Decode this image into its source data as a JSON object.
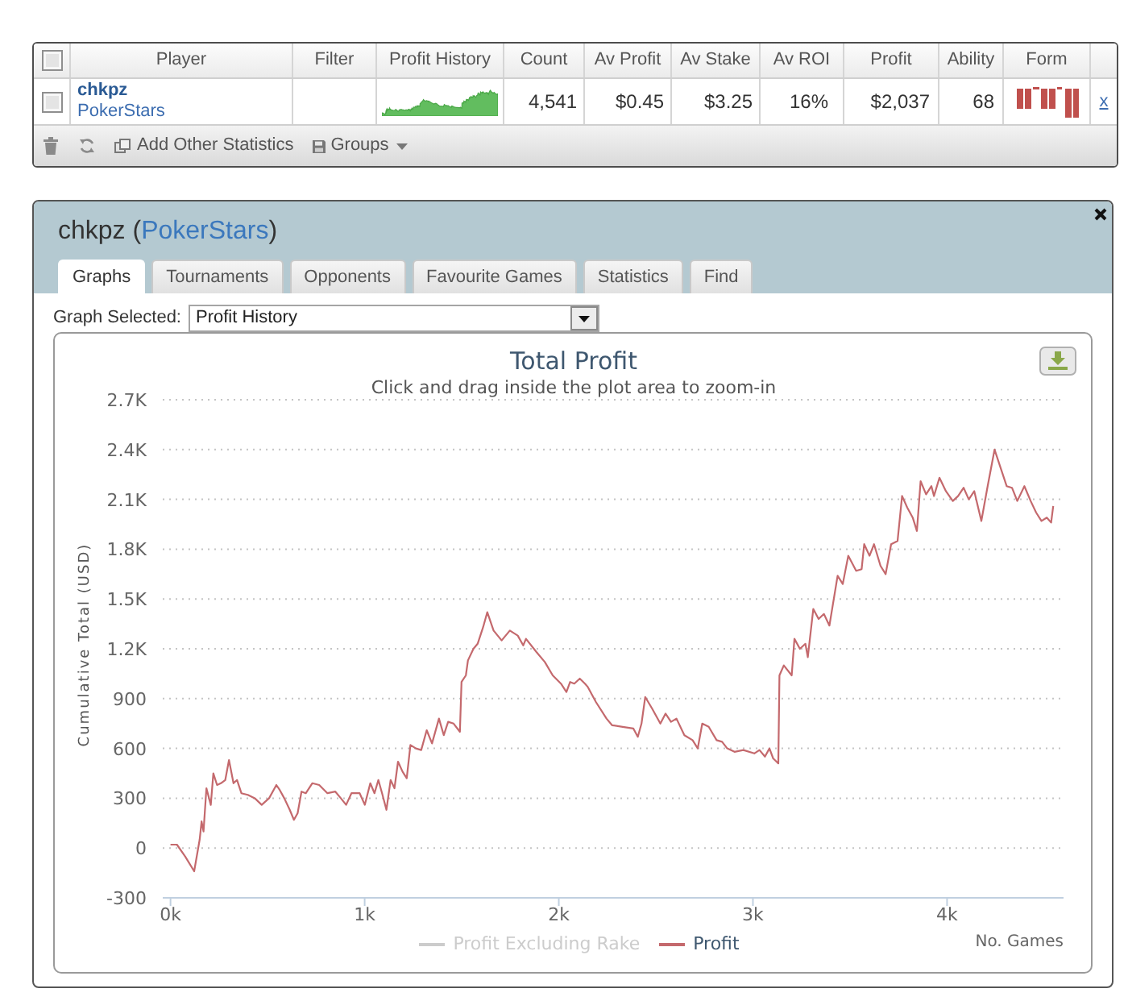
{
  "stats_table": {
    "header_checkbox": {
      "checked": false
    },
    "columns": [
      "Player",
      "Filter",
      "Profit History",
      "Count",
      "Av Profit",
      "Av Stake",
      "Av ROI",
      "Profit",
      "Ability",
      "Form"
    ],
    "rows": [
      {
        "checked": false,
        "player": "chkpz",
        "site": "PokerStars",
        "count": "4,541",
        "av_profit": "$0.45",
        "av_stake": "$3.25",
        "av_roi": "16%",
        "profit": "$2,037",
        "ability": "68",
        "remove": "x"
      }
    ],
    "toolbar": [
      {
        "kind": "delete"
      },
      {
        "kind": "refresh"
      },
      {
        "kind": "add",
        "label": "Add Other Statistics"
      },
      {
        "kind": "groups",
        "label": "Groups"
      }
    ]
  },
  "profile_panel": {
    "title": [
      {
        "kind": "text",
        "text": "chkpz ("
      },
      {
        "kind": "link",
        "text": "PokerStars"
      },
      {
        "kind": "text",
        "text": ")"
      }
    ],
    "tabs": [
      {
        "label": "Graphs",
        "selected": true
      },
      {
        "label": "Tournaments",
        "selected": false
      },
      {
        "label": "Opponents",
        "selected": false
      },
      {
        "label": "Favourite Games",
        "selected": false
      },
      {
        "label": "Statistics",
        "selected": false
      },
      {
        "label": "Find",
        "selected": false
      }
    ],
    "graph_selector": {
      "label": "Graph Selected:",
      "value": "Profit History"
    },
    "chart": {
      "subtitle": "Click and drag inside the plot area to zoom-in",
      "legend": [
        {
          "on": false
        },
        {
          "on": true
        }
      ],
      "chart_data": {
        "type": "line",
        "title": "Total Profit",
        "xlabel": "No. Games",
        "ylabel": "Cumulative Total (USD)",
        "grid": true,
        "x": [
          0,
          33,
          75,
          122,
          150,
          160,
          170,
          185,
          207,
          221,
          240,
          260,
          282,
          301,
          324,
          343,
          365,
          398,
          434,
          470,
          508,
          545,
          563,
          586,
          614,
          636,
          655,
          675,
          697,
          730,
          766,
          808,
          849,
          877,
          905,
          932,
          974,
          1001,
          1029,
          1051,
          1071,
          1090,
          1112,
          1134,
          1154,
          1172,
          1195,
          1217,
          1236,
          1264,
          1291,
          1320,
          1347,
          1383,
          1408,
          1430,
          1458,
          1491,
          1499,
          1521,
          1532,
          1560,
          1582,
          1610,
          1632,
          1664,
          1706,
          1748,
          1789,
          1817,
          1831,
          1886,
          1928,
          1969,
          2011,
          2039,
          2058,
          2080,
          2108,
          2135,
          2150,
          2191,
          2246,
          2274,
          2329,
          2384,
          2407,
          2426,
          2445,
          2481,
          2523,
          2550,
          2578,
          2606,
          2647,
          2689,
          2716,
          2739,
          2772,
          2813,
          2841,
          2868,
          2905,
          2951,
          3007,
          3034,
          3062,
          3085,
          3104,
          3131,
          3137,
          3159,
          3200,
          3214,
          3242,
          3270,
          3283,
          3311,
          3338,
          3366,
          3394,
          3436,
          3463,
          3491,
          3532,
          3560,
          3573,
          3601,
          3624,
          3657,
          3684,
          3712,
          3745,
          3768,
          3795,
          3823,
          3845,
          3864,
          3892,
          3919,
          3933,
          3961,
          3994,
          4030,
          4057,
          4085,
          4112,
          4140,
          4177,
          4209,
          4245,
          4279,
          4307,
          4334,
          4362,
          4398,
          4431,
          4459,
          4486,
          4514,
          4536,
          4547
        ],
        "series": [
          {
            "name": "Profit Excluding Rake",
            "values": [
              null,
              null,
              null,
              null,
              null,
              null,
              null,
              null,
              null,
              null,
              null,
              null,
              null,
              null,
              null,
              null,
              null,
              null,
              null,
              null,
              null,
              null,
              null,
              null,
              null,
              null,
              null,
              null,
              null,
              null,
              null,
              null,
              null,
              null,
              null,
              null,
              null,
              null,
              null,
              null,
              null,
              null,
              null,
              null,
              null,
              null,
              null,
              null,
              null,
              null,
              null,
              null,
              null,
              null,
              null,
              null,
              null,
              null,
              null,
              null,
              null,
              null,
              null,
              null,
              null,
              null,
              null,
              null,
              null,
              null,
              null,
              null,
              null,
              null,
              null,
              null,
              null,
              null,
              null,
              null,
              null,
              null,
              null,
              null,
              null,
              null,
              null,
              null,
              null,
              null,
              null,
              null,
              null,
              null,
              null,
              null,
              null,
              null,
              null,
              null,
              null,
              null,
              null,
              null,
              null,
              null,
              null,
              null,
              null,
              null,
              null,
              null,
              null,
              null,
              null,
              null,
              null,
              null,
              null,
              null,
              null,
              null,
              null,
              null,
              null,
              null,
              null,
              null,
              null,
              null,
              null,
              null,
              null,
              null,
              null,
              null,
              null,
              null,
              null,
              null,
              null,
              null,
              null,
              null,
              null,
              null,
              null,
              null,
              null,
              null,
              null,
              null,
              null,
              null,
              null,
              null,
              null,
              null,
              null,
              null,
              null,
              null
            ]
          },
          {
            "name": "Profit",
            "color": "#c4696d",
            "values": [
              20,
              20,
              -50,
              -140,
              50,
              160,
              100,
              360,
              260,
              450,
              380,
              390,
              410,
              530,
              390,
              410,
              330,
              320,
              300,
              260,
              300,
              380,
              350,
              300,
              230,
              170,
              210,
              340,
              330,
              390,
              380,
              330,
              340,
              300,
              260,
              330,
              330,
              260,
              390,
              330,
              410,
              330,
              230,
              410,
              360,
              520,
              460,
              420,
              620,
              600,
              590,
              710,
              630,
              780,
              680,
              760,
              750,
              700,
              1000,
              1040,
              1130,
              1200,
              1230,
              1330,
              1420,
              1310,
              1250,
              1310,
              1280,
              1220,
              1260,
              1180,
              1120,
              1040,
              990,
              940,
              1000,
              990,
              1020,
              990,
              970,
              880,
              780,
              740,
              730,
              720,
              670,
              750,
              910,
              840,
              750,
              810,
              760,
              780,
              680,
              650,
              600,
              750,
              730,
              650,
              640,
              600,
              580,
              590,
              570,
              590,
              550,
              600,
              540,
              510,
              1040,
              1100,
              1040,
              1260,
              1200,
              1230,
              1150,
              1440,
              1380,
              1410,
              1340,
              1640,
              1590,
              1760,
              1670,
              1680,
              1830,
              1760,
              1830,
              1700,
              1650,
              1830,
              1850,
              2120,
              2050,
              1990,
              1910,
              2210,
              2130,
              2180,
              2120,
              2230,
              2150,
              2090,
              2120,
              2170,
              2100,
              2150,
              1970,
              2180,
              2400,
              2280,
              2180,
              2170,
              2090,
              2180,
              2090,
              2020,
              1970,
              1990,
              1960,
              2060
            ]
          }
        ],
        "xlim": [
          -40,
          4600
        ],
        "ylim": [
          -300,
          2700
        ],
        "xticks": [
          {
            "value": 0,
            "label": "0k"
          },
          {
            "value": 1000,
            "label": "1k"
          },
          {
            "value": 2000,
            "label": "2k"
          },
          {
            "value": 3000,
            "label": "3k"
          },
          {
            "value": 4000,
            "label": "4k"
          }
        ],
        "yticks": [
          -300,
          0,
          300,
          600,
          900,
          {
            "value": 1200,
            "label": "1.2K"
          },
          {
            "value": 1500,
            "label": "1.5K"
          },
          {
            "value": 1800,
            "label": "1.8K"
          },
          {
            "value": 2100,
            "label": "2.1K"
          },
          {
            "value": 2400,
            "label": "2.4K"
          },
          {
            "value": 2700,
            "label": "2.7K"
          }
        ]
      }
    }
  }
}
